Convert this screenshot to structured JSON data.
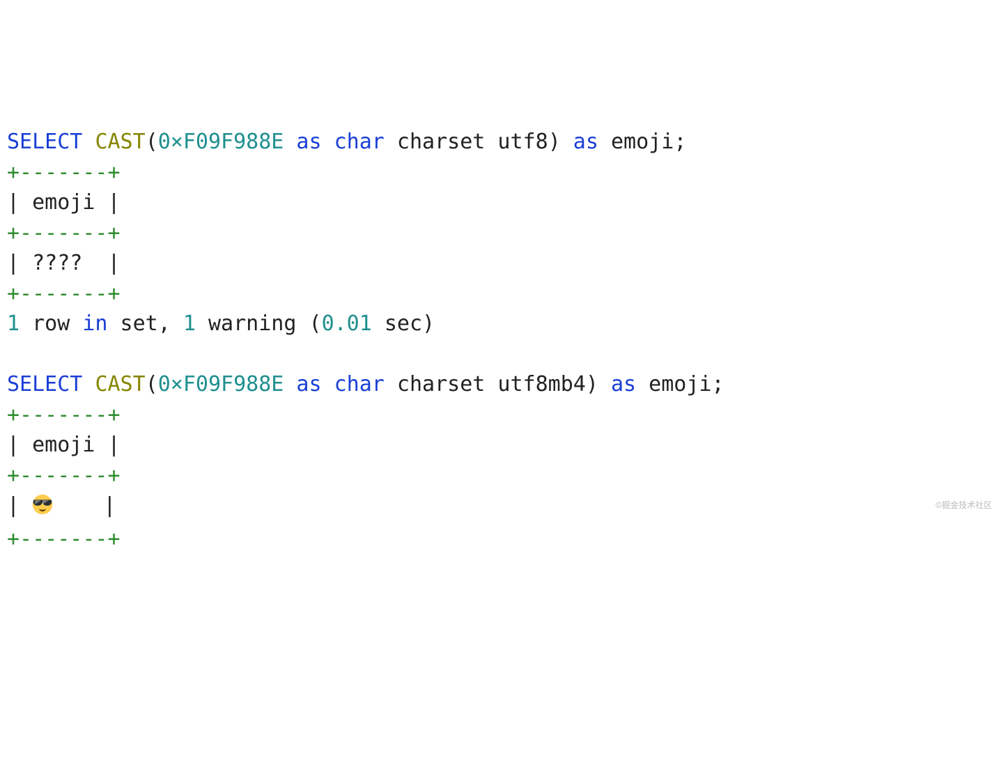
{
  "colors": {
    "keyword": "#1a3fd6",
    "function": "#858500",
    "number": "#1f8f8f",
    "border": "#2e8b2e",
    "text": "#222"
  },
  "query1": {
    "kw_select": "SELECT",
    "fn_cast": "CAST",
    "lparen": "(",
    "hex": "0×F09F988E",
    "kw_as1": " as ",
    "kw_char": "char",
    "lit_charset": " charset utf8",
    "rparen": ")",
    "kw_as2": " as ",
    "alias": "emoji",
    "semi": ";",
    "border": "+-------+",
    "header_row": "| emoji |",
    "value_row": "| ????  |",
    "status_num1": "1",
    "status_txt1": " row ",
    "status_kw_in": "in",
    "status_txt2": " set, ",
    "status_num2": "1",
    "status_txt3": " warning (",
    "status_time": "0.01",
    "status_txt4": " sec)"
  },
  "query2": {
    "kw_select": "SELECT",
    "fn_cast": "CAST",
    "lparen": "(",
    "hex": "0×F09F988E",
    "kw_as1": " as ",
    "kw_char": "char",
    "lit_charset": " charset utf8mb4",
    "rparen": ")",
    "kw_as2": " as ",
    "alias": "emoji",
    "semi": ";",
    "border": "+-------+",
    "header_row": "| emoji |",
    "value_pre": "| ",
    "value_emoji": "😎",
    "value_post": "    |"
  },
  "watermark": "©掘金技术社区"
}
